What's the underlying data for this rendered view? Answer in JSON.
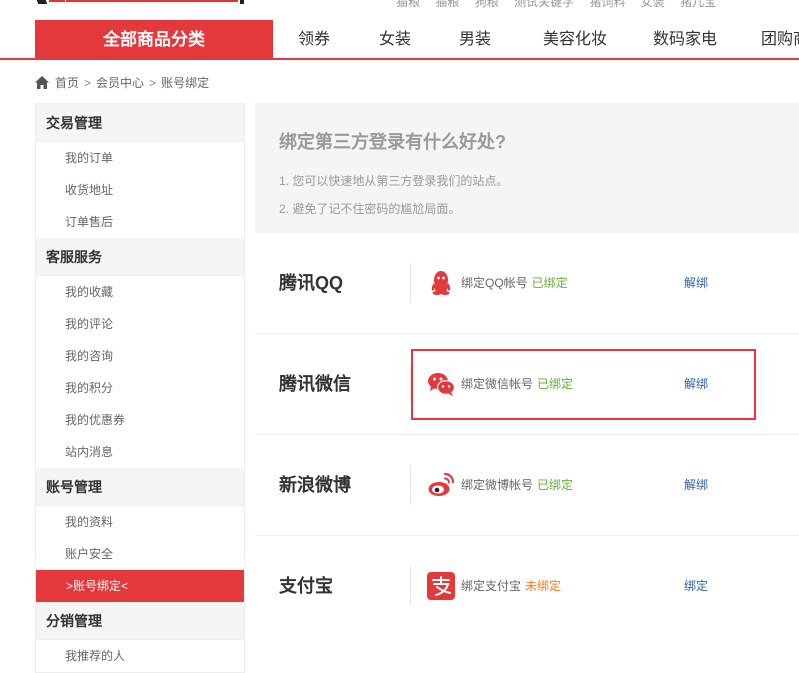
{
  "top": {
    "hot_words": [
      "猫粮",
      "猫粮",
      "狗粮",
      "测试关键字",
      "猪饲料",
      "女装",
      "猪儿宝"
    ]
  },
  "nav": {
    "all_categories": "全部商品分类",
    "items": [
      "领券",
      "女装",
      "男装",
      "美容化妆",
      "数码家电",
      "团购商"
    ]
  },
  "breadcrumb": {
    "home": "首页",
    "sep1": ">",
    "level1": "会员中心",
    "sep2": ">",
    "level2": "账号绑定"
  },
  "sidebar": {
    "group1": {
      "title": "交易管理",
      "items": [
        "我的订单",
        "收货地址",
        "订单售后"
      ]
    },
    "group2": {
      "title": "客服服务",
      "items": [
        "我的收藏",
        "我的评论",
        "我的咨询",
        "我的积分",
        "我的优惠券",
        "站内消息"
      ]
    },
    "group3": {
      "title": "账号管理",
      "items": [
        "我的资料",
        "账户安全",
        ">账号绑定<"
      ]
    },
    "group4": {
      "title": "分销管理",
      "items": [
        "我推荐的人"
      ]
    }
  },
  "benefits": {
    "title": "绑定第三方登录有什么好处?",
    "line1": "1. 您可以快速地从第三方登录我们的站点。",
    "line2": "2. 避免了记不住密码的尴尬局面。"
  },
  "bindings": [
    {
      "name": "腾讯QQ",
      "text": "绑定QQ帐号",
      "status": "已绑定",
      "action": "解绑",
      "icon": "qq-icon",
      "color": "#e4393c"
    },
    {
      "name": "腾讯微信",
      "text": "绑定微信帐号",
      "status": "已绑定",
      "action": "解绑",
      "icon": "wechat-icon",
      "color": "#e4393c"
    },
    {
      "name": "新浪微博",
      "text": "绑定微博帐号",
      "status": "已绑定",
      "action": "解绑",
      "icon": "weibo-icon",
      "color": "#e4393c"
    },
    {
      "name": "支付宝",
      "text": "绑定支付宝",
      "status": "未绑定",
      "action": "绑定",
      "icon": "alipay-icon",
      "color": "#e4393c"
    }
  ],
  "colors": {
    "accent": "#e4393c",
    "bound": "#5fb336",
    "unbound": "#ff7a1a",
    "link": "#2d5fb5"
  }
}
